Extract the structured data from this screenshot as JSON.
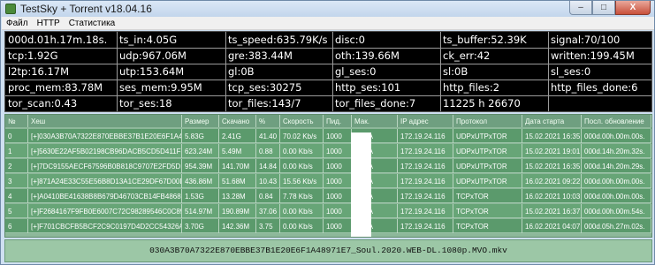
{
  "window": {
    "title": "TestSky + Torrent v18.04.16",
    "minimize": "–",
    "maximize": "□",
    "close": "X"
  },
  "menu": [
    "Файл",
    "HTTP",
    "Статистика"
  ],
  "stats": [
    [
      "000d.01h.17m.18s.",
      "ts_in:4.05G",
      "ts_speed:635.79K/s",
      "disc:0",
      "ts_buffer:52.39K",
      "signal:70/100"
    ],
    [
      "tcp:1.92G",
      "udp:967.06M",
      "gre:383.44M",
      "oth:139.66M",
      "ck_err:42",
      "written:199.45M"
    ],
    [
      "l2tp:16.17M",
      "utp:153.64M",
      "gl:0B",
      "gl_ses:0",
      "sl:0B",
      "sl_ses:0"
    ],
    [
      "proc_mem:83.78M",
      "ses_mem:9.95M",
      "tcp_ses:30275",
      "http_ses:101",
      "http_files:2",
      "http_files_done:6"
    ],
    [
      "tor_scan:0.43",
      "tor_ses:18",
      "tor_files:143/7",
      "tor_files_done:7",
      "11225 h 26670",
      ""
    ]
  ],
  "table": {
    "headers": [
      "№",
      "Хеш",
      "Размер",
      "Скачано",
      "%",
      "Скорость",
      "Пид.",
      "Мак.",
      "IP адрес",
      "Протокол",
      "Дата старта",
      "Посл. обновление"
    ],
    "rows": [
      [
        "0",
        "[+]030A3B70A7322E870EBBE37B1E20E6F1A4897",
        "5.83G",
        "2.41G",
        "41.40",
        "70.02 Kb/s",
        "1000",
        "6DBA",
        "172.19.24.116",
        "UDPxUTPxTOR",
        "15.02.2021 16:35:56",
        "000d.00h.00m.00s."
      ],
      [
        "1",
        "[+]5630E22AF5B02198CB96DACB5CD5D411F5B9",
        "623.24M",
        "5.49M",
        "0.88",
        "0.00 Kb/s",
        "1000",
        "6DBA",
        "172.19.24.116",
        "UDPxUTPxTOR",
        "15.02.2021 19:01:47",
        "000d.14h.20m.32s."
      ],
      [
        "2",
        "[+]7DC9155AECF67596B0B818C9707E2FD5D19A",
        "954.39M",
        "141.70M",
        "14.84",
        "0.00 Kb/s",
        "1000",
        "6DBA",
        "172.19.24.116",
        "UDPxUTPxTOR",
        "15.02.2021 16:35:36",
        "000d.14h.20m.29s."
      ],
      [
        "3",
        "[+]871A24E33C55E56B8D13A1CE29DF67D00DA8",
        "436.86M",
        "51.68M",
        "10.43",
        "15.56 Kb/s",
        "1000",
        "6DBA",
        "172.19.24.116",
        "UDPxUTPxTOR",
        "16.02.2021 09:22:51",
        "000d.00h.00m.00s."
      ],
      [
        "4",
        "[+]A0410BE41638B8B679D46703CB14FB4868BE",
        "1.53G",
        "13.28M",
        "0.84",
        "7.78 Kb/s",
        "1000",
        "6DBA",
        "172.19.24.116",
        "TCPxTOR",
        "16.02.2021 10:03:12",
        "000d.00h.00m.00s."
      ],
      [
        "5",
        "[+]F2684167F9FB0E6007C72C98289546C0C89CF",
        "514.97M",
        "190.89M",
        "37.06",
        "0.00 Kb/s",
        "1000",
        "6DBA",
        "172.19.24.116",
        "TCPxTOR",
        "15.02.2021 16:37:03",
        "000d.00h.00m.54s."
      ],
      [
        "6",
        "[+]F701CBCFB5BCF2C9C0197D4D2CC54326A84B",
        "3.70G",
        "142.36M",
        "3.75",
        "0.00 Kb/s",
        "1000",
        "6DBA",
        "172.19.24.116",
        "TCPxTOR",
        "16.02.2021 04:07:15",
        "000d.05h.27m.02s."
      ]
    ]
  },
  "status_bar": "030A3B70A7322E870EBBE37B1E20E6F1A48971E7_Soul.2020.WEB-DL.1080p.MVO.mkv"
}
